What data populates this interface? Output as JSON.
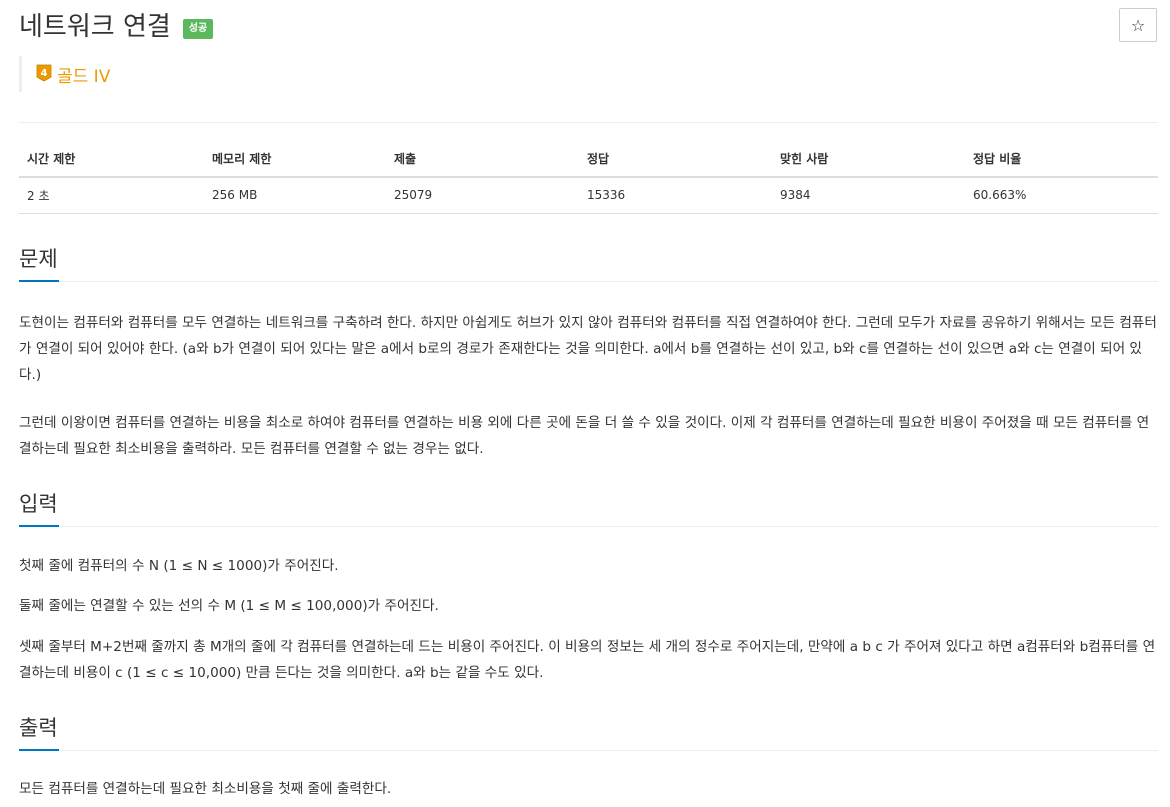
{
  "problem": {
    "title": "네트워크 연결",
    "status_badge": "성공",
    "star_label": "☆",
    "tier_number": "4",
    "tier_label": "골드 IV"
  },
  "stats": {
    "headers": [
      "시간 제한",
      "메모리 제한",
      "제출",
      "정답",
      "맞힌 사람",
      "정답 비율"
    ],
    "values": [
      "2 초",
      "256 MB",
      "25079",
      "15336",
      "9384",
      "60.663%"
    ]
  },
  "sections": {
    "problem": {
      "heading": "문제",
      "paragraphs": [
        "도현이는 컴퓨터와 컴퓨터를 모두 연결하는 네트워크를 구축하려 한다. 하지만 아쉽게도 허브가 있지 않아 컴퓨터와 컴퓨터를 직접 연결하여야 한다. 그런데 모두가 자료를 공유하기 위해서는 모든 컴퓨터가 연결이 되어 있어야 한다. (a와 b가 연결이 되어 있다는 말은 a에서 b로의 경로가 존재한다는 것을 의미한다. a에서 b를 연결하는 선이 있고, b와 c를 연결하는 선이 있으면 a와 c는 연결이 되어 있다.)",
        "그런데 이왕이면 컴퓨터를 연결하는 비용을 최소로 하여야 컴퓨터를 연결하는 비용 외에 다른 곳에 돈을 더 쓸 수 있을 것이다. 이제 각 컴퓨터를 연결하는데 필요한 비용이 주어졌을 때 모든 컴퓨터를 연결하는데 필요한 최소비용을 출력하라. 모든 컴퓨터를 연결할 수 없는 경우는 없다."
      ]
    },
    "input": {
      "heading": "입력",
      "paragraphs": [
        "첫째 줄에 컴퓨터의 수 N (1 ≤ N ≤ 1000)가 주어진다.",
        "둘째 줄에는 연결할 수 있는 선의 수 M (1 ≤ M ≤ 100,000)가 주어진다.",
        "셋째 줄부터 M+2번째 줄까지 총 M개의 줄에 각 컴퓨터를 연결하는데 드는 비용이 주어진다. 이 비용의 정보는 세 개의 정수로 주어지는데, 만약에 a b c 가 주어져 있다고 하면 a컴퓨터와 b컴퓨터를 연결하는데 비용이 c (1 ≤ c ≤ 10,000) 만큼 든다는 것을 의미한다. a와 b는 같을 수도 있다."
      ]
    },
    "output": {
      "heading": "출력",
      "paragraphs": [
        "모든 컴퓨터를 연결하는데 필요한 최소비용을 첫째 줄에 출력한다."
      ]
    }
  },
  "colors": {
    "success_badge": "#5cb85c",
    "tier_gold": "#ec9a00",
    "section_accent": "#0076c0"
  }
}
